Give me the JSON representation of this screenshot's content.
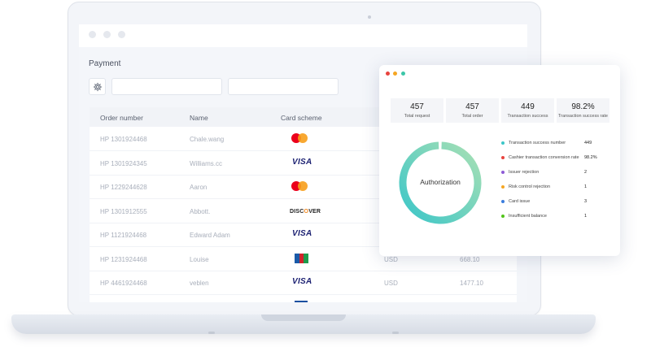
{
  "payment": {
    "title": "Payment",
    "columns": [
      "Order number",
      "Name",
      "Card scheme"
    ],
    "rows": [
      {
        "order": "HP 1301924468",
        "name": "Chale.wang",
        "scheme": "mastercard",
        "currency": "",
        "amount": ""
      },
      {
        "order": "HP 1301924345",
        "name": "Williams.cc",
        "scheme": "visa",
        "currency": "",
        "amount": ""
      },
      {
        "order": "HP 1229244628",
        "name": "Aaron",
        "scheme": "mastercard",
        "currency": "",
        "amount": ""
      },
      {
        "order": "HP 1301912555",
        "name": "Abbott.",
        "scheme": "discover",
        "currency": "",
        "amount": ""
      },
      {
        "order": "HP 1121924468",
        "name": "Edward Adam",
        "scheme": "visa",
        "currency": "",
        "amount": ""
      },
      {
        "order": "HP 1231924468",
        "name": "Louise",
        "scheme": "jcb",
        "currency": "USD",
        "amount": "668.10"
      },
      {
        "order": "HP 4461924468",
        "name": "veblen",
        "scheme": "visa",
        "currency": "USD",
        "amount": "1477.10"
      }
    ],
    "card_logos": {
      "visa": "VISA",
      "discover_prefix": "DISC",
      "discover_o": "O",
      "discover_suffix": "VER"
    }
  },
  "stats": {
    "kpis": [
      {
        "value": "457",
        "label": "Total request"
      },
      {
        "value": "457",
        "label": "Total order"
      },
      {
        "value": "449",
        "label": "Transaction success"
      },
      {
        "value": "98.2%",
        "label": "Transaction success rate"
      }
    ],
    "donut": {
      "label": "Authorization",
      "gradient_from": "#3cc6c8",
      "gradient_to": "#a8e0b4"
    },
    "legend": [
      {
        "label": "Transaction success number",
        "value": "449",
        "color": "#3cc6c8"
      },
      {
        "label": "Cashier transaction conversion rate",
        "value": "98.2%",
        "color": "#e8433e"
      },
      {
        "label": "Issuer rejection",
        "value": "2",
        "color": "#8e5bd6"
      },
      {
        "label": "Risk control rejection",
        "value": "1",
        "color": "#f5a623"
      },
      {
        "label": "Card issue",
        "value": "3",
        "color": "#3b7ddd"
      },
      {
        "label": "Insufficient balance",
        "value": "1",
        "color": "#52c41a"
      }
    ]
  },
  "colors": {
    "window_dot_red": "#e8433e",
    "window_dot_yellow": "#f5a623",
    "window_dot_green": "#3cc6a8"
  }
}
